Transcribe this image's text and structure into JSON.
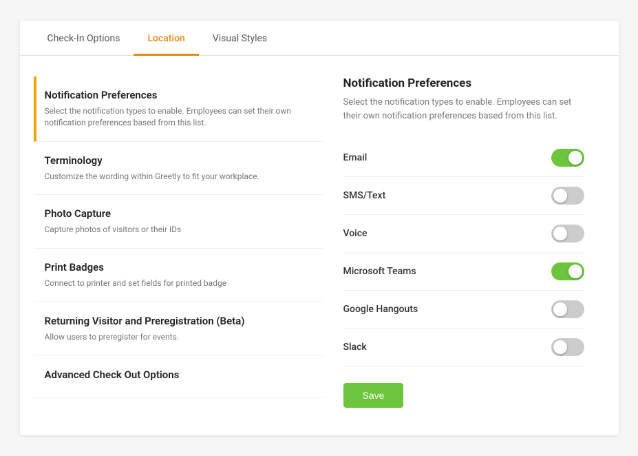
{
  "tabs": [
    {
      "id": "check-in-options",
      "label": "Check-In Options",
      "active": false
    },
    {
      "id": "location",
      "label": "Location",
      "active": true
    },
    {
      "id": "visual-styles",
      "label": "Visual Styles",
      "active": false
    }
  ],
  "sidebar": {
    "items": [
      {
        "id": "notification-preferences",
        "title": "Notification Preferences",
        "description": "Select the notification types to enable. Employees can set their own notification preferences based from this list.",
        "active": true
      },
      {
        "id": "terminology",
        "title": "Terminology",
        "description": "Customize the wording within Greetly to fit your workplace.",
        "active": false
      },
      {
        "id": "photo-capture",
        "title": "Photo Capture",
        "description": "Capture photos of visitors or their IDs",
        "active": false
      },
      {
        "id": "print-badges",
        "title": "Print Badges",
        "description": "Connect to printer and set fields for printed badge",
        "active": false
      },
      {
        "id": "returning-visitor",
        "title": "Returning Visitor and Preregistration (Beta)",
        "description": "Allow users to preregister for events.",
        "active": false
      },
      {
        "id": "advanced-check-out",
        "title": "Advanced Check Out Options",
        "description": "",
        "active": false
      }
    ]
  },
  "right_panel": {
    "title": "Notification Preferences",
    "subtitle": "Select the notification types to enable. Employees can set their own notification preferences based from this list.",
    "toggles": [
      {
        "id": "email",
        "label": "Email",
        "enabled": true
      },
      {
        "id": "sms-text",
        "label": "SMS/Text",
        "enabled": false
      },
      {
        "id": "voice",
        "label": "Voice",
        "enabled": false
      },
      {
        "id": "microsoft-teams",
        "label": "Microsoft Teams",
        "enabled": true
      },
      {
        "id": "google-hangouts",
        "label": "Google Hangouts",
        "enabled": false
      },
      {
        "id": "slack",
        "label": "Slack",
        "enabled": false
      }
    ],
    "save_label": "Save"
  }
}
